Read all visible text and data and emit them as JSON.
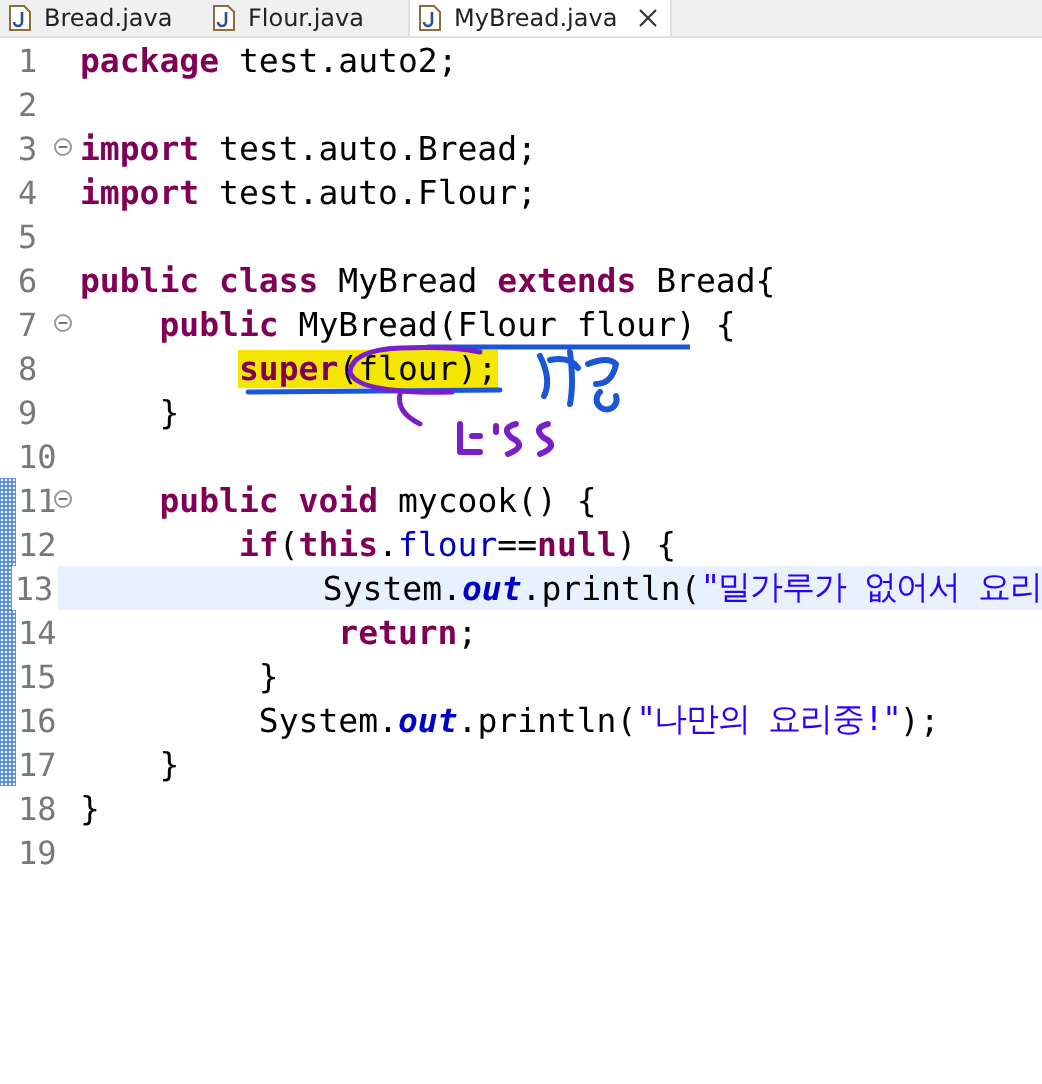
{
  "tabs": [
    {
      "label": "Bread.java",
      "selected": false,
      "closable": false
    },
    {
      "label": "Flour.java",
      "selected": false,
      "closable": false
    },
    {
      "label": "MyBread.java",
      "selected": true,
      "closable": true
    }
  ],
  "editor": {
    "lines": [
      {
        "number": "1",
        "fold": false,
        "changed": false,
        "current": false,
        "tokens": [
          {
            "kind": "keyword",
            "text": "package"
          },
          {
            "kind": "plain",
            "text": " test.auto2;"
          }
        ]
      },
      {
        "number": "2",
        "fold": false,
        "changed": false,
        "current": false
      },
      {
        "number": "3",
        "fold": true,
        "changed": false,
        "current": false,
        "tokens": [
          {
            "kind": "keyword",
            "text": "import"
          },
          {
            "kind": "plain",
            "text": " test.auto.Bread;"
          }
        ]
      },
      {
        "number": "4",
        "fold": false,
        "changed": false,
        "current": false,
        "tokens": [
          {
            "kind": "keyword",
            "text": "import"
          },
          {
            "kind": "plain",
            "text": " test.auto.Flour;"
          }
        ]
      },
      {
        "number": "5",
        "fold": false,
        "changed": false,
        "current": false
      },
      {
        "number": "6",
        "fold": false,
        "changed": false,
        "current": false,
        "tokens": [
          {
            "kind": "keyword",
            "text": "public class"
          },
          {
            "kind": "plain",
            "text": " MyBread "
          },
          {
            "kind": "keyword",
            "text": "extends"
          },
          {
            "kind": "plain",
            "text": " Bread{"
          }
        ]
      },
      {
        "number": "7",
        "fold": true,
        "changed": false,
        "current": false,
        "tokens": [
          {
            "kind": "keyword",
            "text": "    public"
          },
          {
            "kind": "plain",
            "text": " MyBread(Flour flour) {"
          }
        ]
      },
      {
        "number": "8",
        "fold": false,
        "changed": false,
        "current": false,
        "tokens": [
          {
            "kind": "keyword",
            "text": "        super",
            "marked": true
          },
          {
            "kind": "plain",
            "text": "(flour);",
            "marked": true
          }
        ]
      },
      {
        "number": "9",
        "fold": false,
        "changed": false,
        "current": false,
        "tokens": [
          {
            "kind": "plain",
            "text": "    }"
          }
        ]
      },
      {
        "number": "10",
        "fold": false,
        "changed": false,
        "current": false
      },
      {
        "number": "11",
        "fold": true,
        "changed": true,
        "current": false,
        "tokens": [
          {
            "kind": "keyword",
            "text": "    public void"
          },
          {
            "kind": "plain",
            "text": " mycook() {"
          }
        ]
      },
      {
        "number": "12",
        "fold": false,
        "changed": true,
        "current": false,
        "tokens": [
          {
            "kind": "keyword",
            "text": "        if"
          },
          {
            "kind": "plain",
            "text": "("
          },
          {
            "kind": "keyword",
            "text": "this"
          },
          {
            "kind": "plain",
            "text": "."
          },
          {
            "kind": "field",
            "text": "flour"
          },
          {
            "kind": "plain",
            "text": "=="
          },
          {
            "kind": "keyword",
            "text": "null"
          },
          {
            "kind": "plain",
            "text": ") {"
          }
        ]
      },
      {
        "number": "13",
        "fold": false,
        "changed": true,
        "current": true,
        "tokens": [
          {
            "kind": "plain",
            "text": "             System."
          },
          {
            "kind": "static",
            "text": "out"
          },
          {
            "kind": "plain",
            "text": ".println("
          },
          {
            "kind": "string",
            "text": "\"밀가루가 없어서 요리"
          }
        ]
      },
      {
        "number": "14",
        "fold": false,
        "changed": true,
        "current": false,
        "tokens": [
          {
            "kind": "keyword",
            "text": "             return"
          },
          {
            "kind": "plain",
            "text": ";"
          }
        ]
      },
      {
        "number": "15",
        "fold": false,
        "changed": true,
        "current": false,
        "tokens": [
          {
            "kind": "plain",
            "text": "         }"
          }
        ]
      },
      {
        "number": "16",
        "fold": false,
        "changed": true,
        "current": false,
        "tokens": [
          {
            "kind": "plain",
            "text": "         System."
          },
          {
            "kind": "static",
            "text": "out"
          },
          {
            "kind": "plain",
            "text": ".println("
          },
          {
            "kind": "string",
            "text": "\"나만의 요리중!\""
          },
          {
            "kind": "plain",
            "text": ");"
          }
        ]
      },
      {
        "number": "17",
        "fold": false,
        "changed": true,
        "current": false,
        "tokens": [
          {
            "kind": "plain",
            "text": "    }"
          }
        ]
      },
      {
        "number": "18",
        "fold": false,
        "changed": false,
        "current": false,
        "tokens": [
          {
            "kind": "plain",
            "text": "}"
          }
        ]
      },
      {
        "number": "19",
        "fold": false,
        "changed": false,
        "current": false
      }
    ]
  }
}
